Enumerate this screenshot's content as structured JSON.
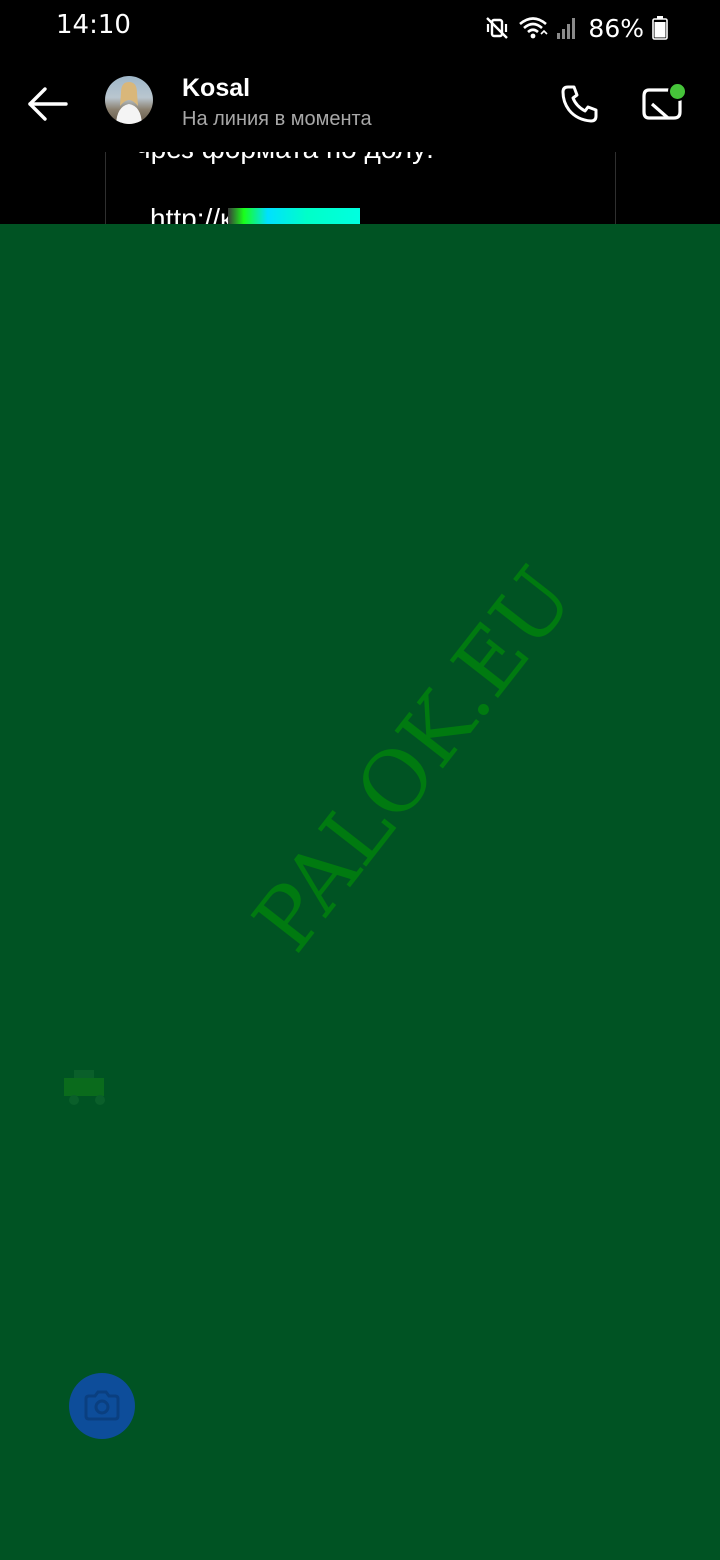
{
  "status_bar": {
    "time": "14:10",
    "battery_percent": "86%",
    "icons": [
      "mute-vibrate-icon",
      "wifi-icon",
      "signal-icon",
      "battery-icon"
    ]
  },
  "header": {
    "contact_name": "Kosal",
    "contact_status": "На линия в момента",
    "back_icon": "arrow-left-icon",
    "call_icon": "phone-icon",
    "video_icon": "video-camera-icon",
    "online_indicator_color": "#46c43a"
  },
  "message": {
    "line1": "чрез формата по долу:",
    "link_partial": "http://к"
  },
  "overlay": {
    "color": "#005323",
    "watermark": "PALOK.EU",
    "watermark_color": "#007a10"
  },
  "composer": {
    "camera_icon": "camera-icon",
    "camera_button_color": "#0d4d9a"
  }
}
